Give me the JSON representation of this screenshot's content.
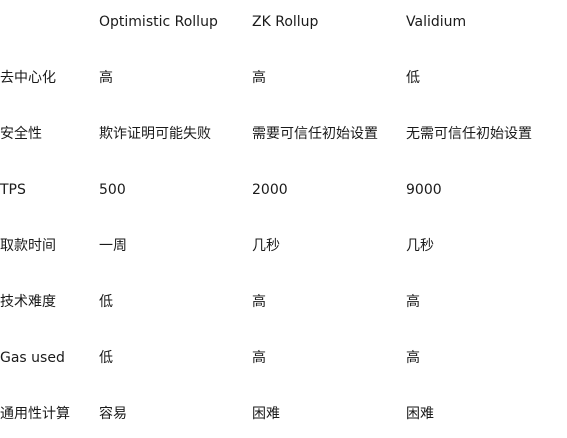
{
  "table": {
    "headers": [
      "",
      "Optimistic Rollup",
      "ZK Rollup",
      "Validium"
    ],
    "rows": [
      [
        "去中心化",
        "高",
        "高",
        "低"
      ],
      [
        "安全性",
        "欺诈证明可能失败",
        "需要可信任初始设置",
        "无需可信任初始设置"
      ],
      [
        "TPS",
        "500",
        "2000",
        "9000"
      ],
      [
        "取款时间",
        "一周",
        "几秒",
        "几秒"
      ],
      [
        "技术难度",
        "低",
        "高",
        "高"
      ],
      [
        "Gas used",
        "低",
        "高",
        "高"
      ],
      [
        "通用性计算",
        "容易",
        "困难",
        "困难"
      ]
    ]
  }
}
